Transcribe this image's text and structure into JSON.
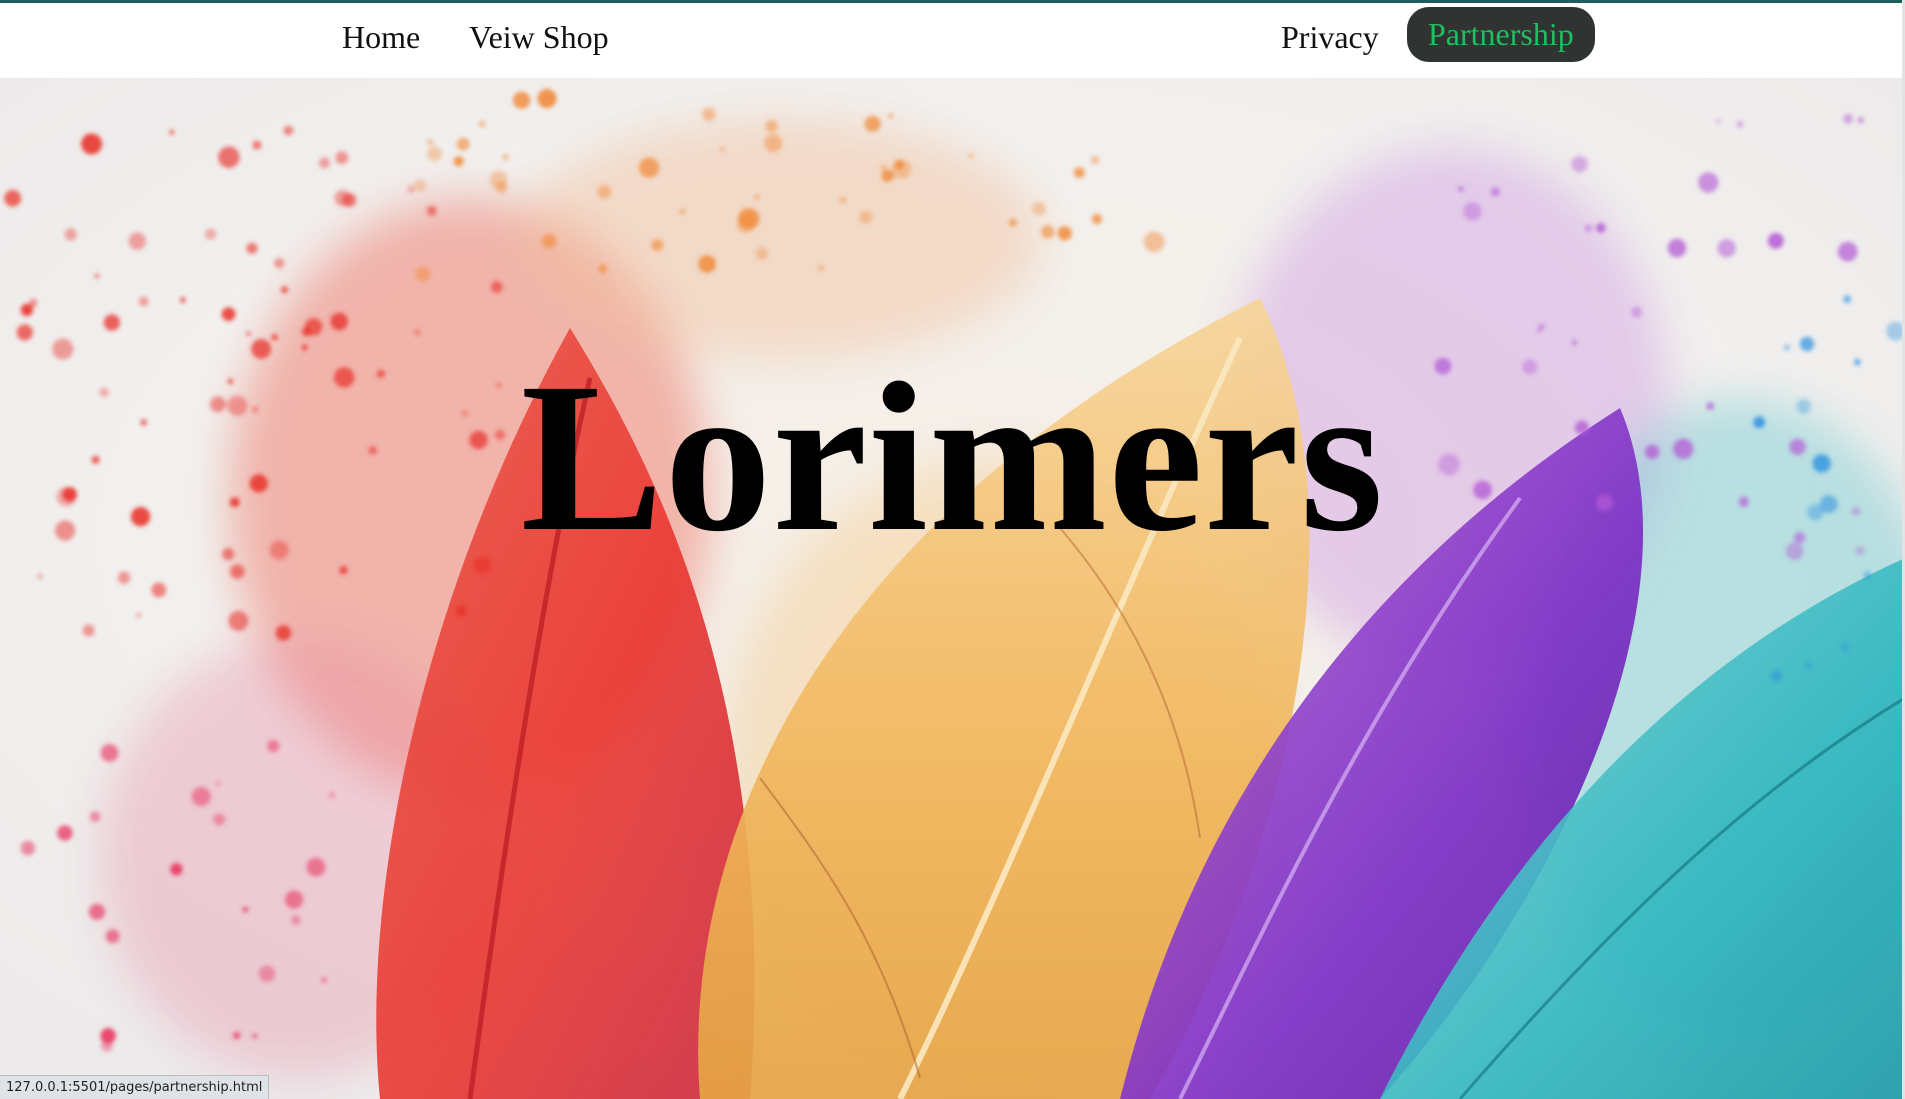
{
  "nav": {
    "home": "Home",
    "shop": "Veiw Shop",
    "privacy": "Privacy",
    "partnership": "Partnership"
  },
  "hero": {
    "title": "Lorimers",
    "image": "watercolor-feathers"
  },
  "status_bar": {
    "url": "127.0.0.1:5501/pages/partnership.html"
  },
  "colors": {
    "active_pill_bg": "#2f3433",
    "active_pill_text": "#1fbf5f",
    "top_line": "#1f5f5b"
  }
}
